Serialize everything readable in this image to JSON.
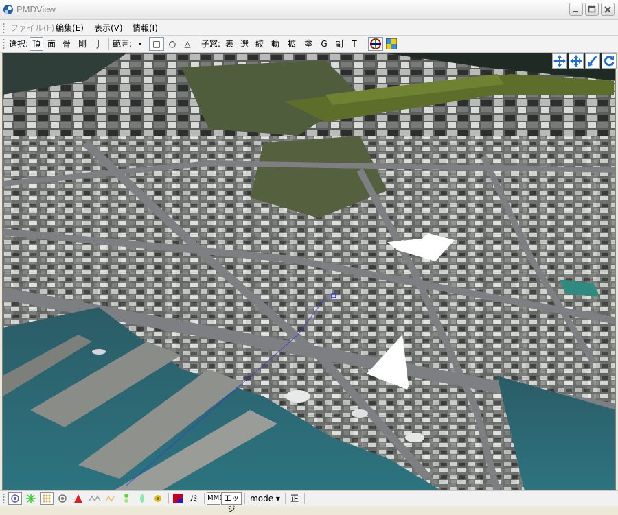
{
  "window": {
    "title": "PMDView"
  },
  "menu": [
    {
      "label": "ファイル(F)",
      "enabled": false
    },
    {
      "label": "編集(E)",
      "enabled": true
    },
    {
      "label": "表示(V)",
      "enabled": true
    },
    {
      "label": "情報(I)",
      "enabled": true
    }
  ],
  "toolbar": {
    "select_label": "選択:",
    "select_buttons": [
      "頂",
      "面",
      "骨",
      "剛",
      "J"
    ],
    "selected_mode": "頂",
    "range_label": "範囲:",
    "range_buttons": [
      "・",
      "□",
      "○",
      "△"
    ],
    "selected_range": "□",
    "child_label": "子窓:",
    "child_buttons": [
      "表",
      "選",
      "絞",
      "動",
      "拡",
      "塗",
      "G",
      "副",
      "T"
    ]
  },
  "viewport": {
    "description_icons": [
      "move-icon",
      "pan-icon",
      "zoom-icon",
      "rotate-icon"
    ]
  },
  "statusbar": {
    "mmd_label": "MMD",
    "edge_label": "エッジ",
    "mode_label": "mode ▾",
    "front_label": "正",
    "cut_label": "ﾉﾐ"
  },
  "colors": {
    "accent": "#3a6fd8",
    "water": "#2a6470",
    "road": "#7d7f82"
  }
}
